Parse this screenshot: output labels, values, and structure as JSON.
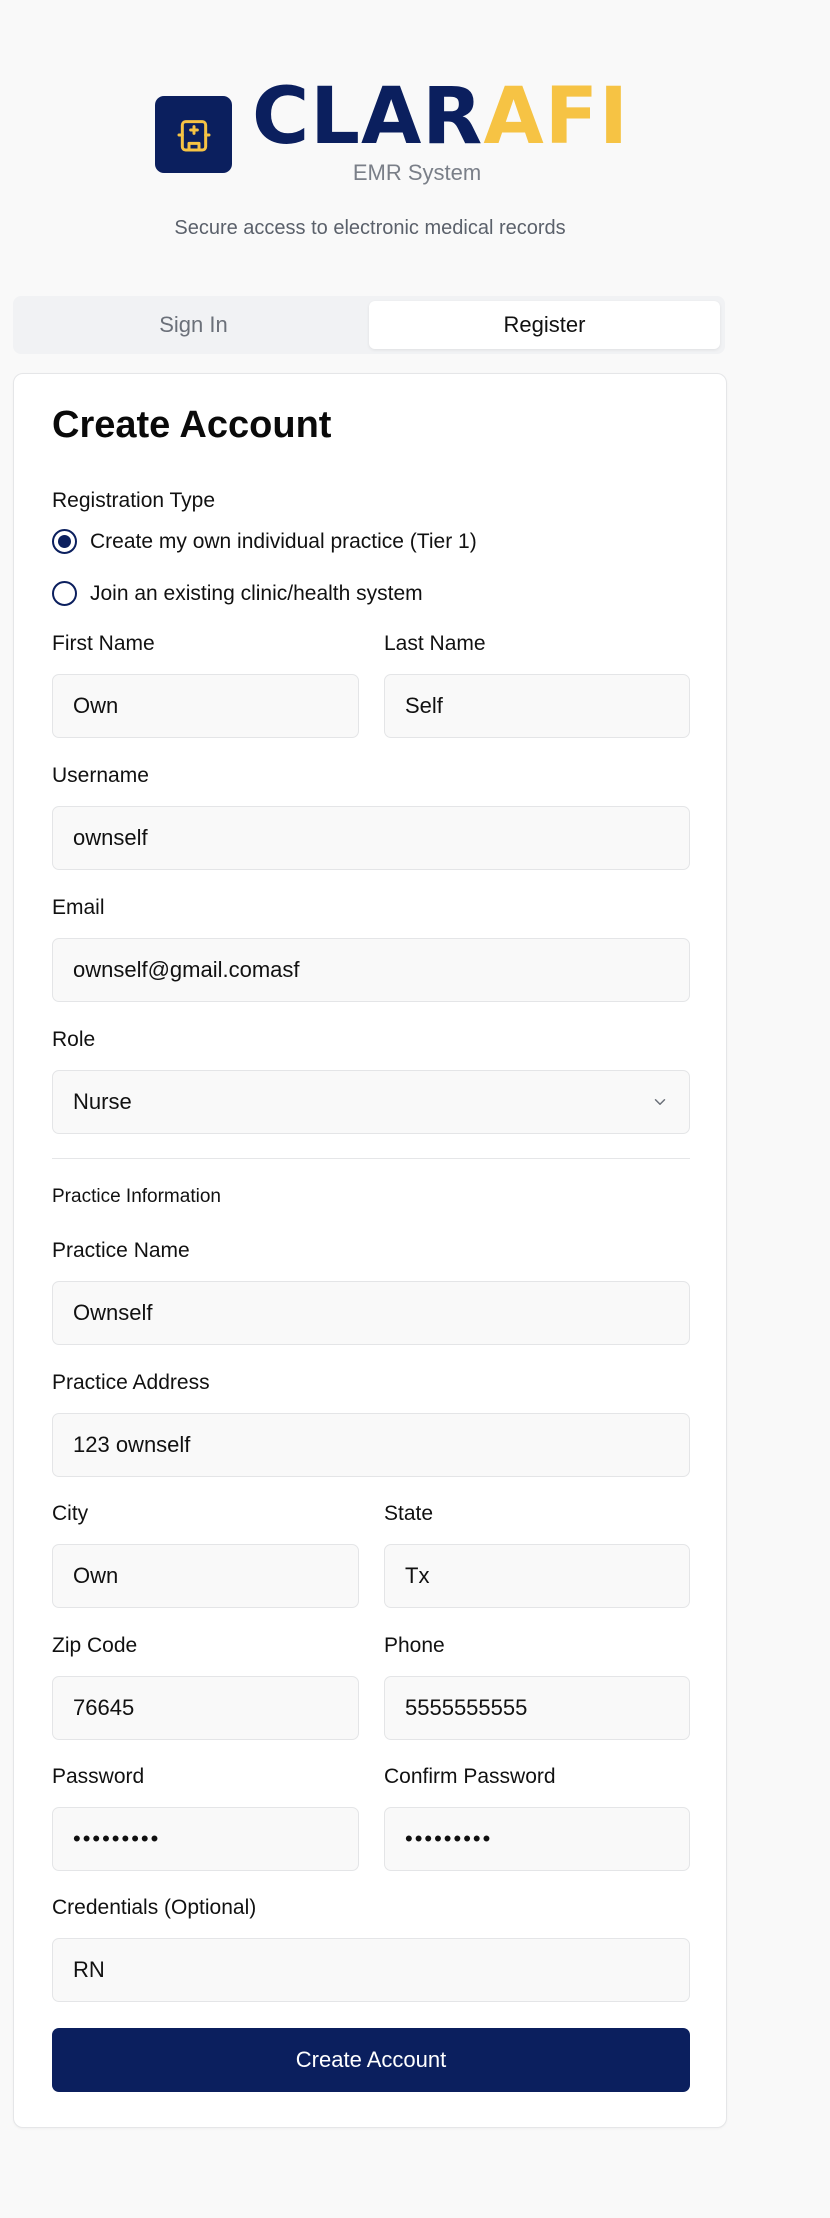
{
  "brand": {
    "name_main": "CLAR",
    "name_accent": "AFI",
    "subtitle": "EMR System",
    "tagline": "Secure access to electronic medical records",
    "icon": "hospital-building-icon",
    "colors": {
      "primary": "#0b1f5e",
      "accent": "#f6c344"
    }
  },
  "tabs": [
    {
      "label": "Sign In",
      "active": false
    },
    {
      "label": "Register",
      "active": true
    }
  ],
  "form": {
    "title": "Create Account",
    "registration_type": {
      "label": "Registration Type",
      "options": [
        {
          "label": "Create my own individual practice (Tier 1)",
          "selected": true
        },
        {
          "label": "Join an existing clinic/health system",
          "selected": false
        }
      ]
    },
    "first_name": {
      "label": "First Name",
      "value": "Own"
    },
    "last_name": {
      "label": "Last Name",
      "value": "Self"
    },
    "username": {
      "label": "Username",
      "value": "ownself"
    },
    "email": {
      "label": "Email",
      "value": "ownself@gmail.comasf"
    },
    "role": {
      "label": "Role",
      "value": "Nurse"
    },
    "practice_section": "Practice Information",
    "practice_name": {
      "label": "Practice Name",
      "value": "Ownself"
    },
    "practice_address": {
      "label": "Practice Address",
      "value": "123 ownself"
    },
    "city": {
      "label": "City",
      "value": "Own"
    },
    "state": {
      "label": "State",
      "value": "Tx"
    },
    "zip": {
      "label": "Zip Code",
      "value": "76645"
    },
    "phone": {
      "label": "Phone",
      "value": "5555555555"
    },
    "password": {
      "label": "Password",
      "value": "•••••••••"
    },
    "confirm_password": {
      "label": "Confirm Password",
      "value": "•••••••••"
    },
    "credentials": {
      "label": "Credentials (Optional)",
      "value": "RN"
    },
    "submit_label": "Create Account"
  }
}
